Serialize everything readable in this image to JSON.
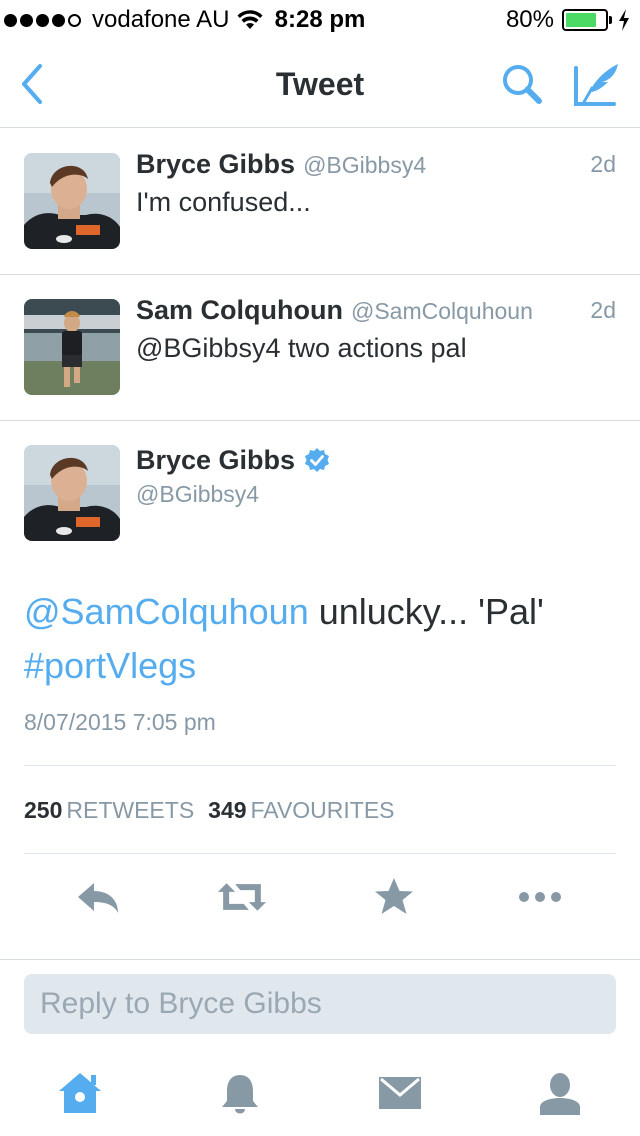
{
  "status_bar": {
    "carrier": "vodafone AU",
    "time": "8:28 pm",
    "battery_percent": "80%",
    "battery_level": 0.8,
    "signal_bars": 4,
    "signal_max": 5
  },
  "nav": {
    "title": "Tweet",
    "back_icon": "chevron-left-icon",
    "search_icon": "search-icon",
    "compose_icon": "compose-icon"
  },
  "tweets": [
    {
      "name": "Bryce Gibbs",
      "handle": "@BGibbsy4",
      "time": "2d",
      "text": "I'm confused..."
    },
    {
      "name": "Sam Colquhoun",
      "handle": "@SamColquhoun",
      "time": "2d",
      "text": "@BGibbsy4 two actions pal"
    }
  ],
  "main_tweet": {
    "name": "Bryce Gibbs",
    "handle": "@BGibbsy4",
    "verified": true,
    "mention": "@SamColquhoun",
    "text_middle": " unlucky... 'Pal' ",
    "hashtag": "#portVlegs",
    "date": "8/07/2015 7:05 pm",
    "retweets_count": "250",
    "retweets_label": "RETWEETS",
    "favourites_count": "349",
    "favourites_label": "FAVOURITES"
  },
  "actions": [
    "reply-icon",
    "retweet-icon",
    "star-icon",
    "more-icon"
  ],
  "reply": {
    "placeholder": "Reply to Bryce Gibbs"
  },
  "tabs": [
    "home-icon",
    "notifications-icon",
    "messages-icon",
    "me-icon"
  ],
  "colors": {
    "accent": "#55acee",
    "text": "#292f33",
    "secondary": "#8899a6",
    "divider": "#d8dde1",
    "battery": "#4cd964"
  }
}
